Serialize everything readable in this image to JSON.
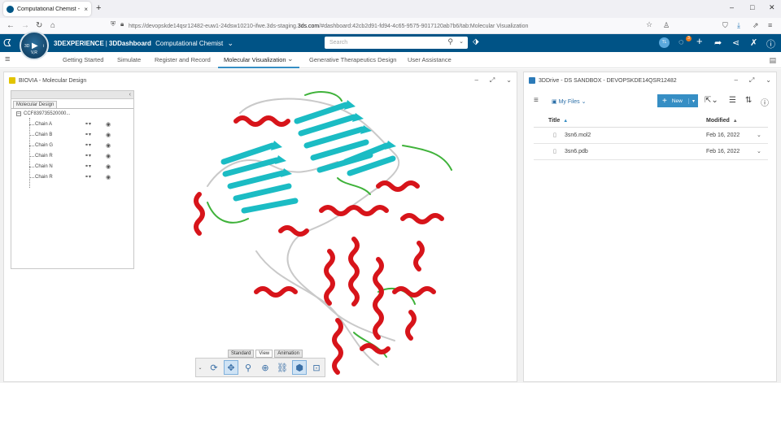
{
  "browser": {
    "tab_title": "Computational Chemist - Mol",
    "tab_close": "×",
    "new_tab": "+",
    "url_prefix": "https://devopskde14qsr12482-euw1-24dsw10210-ifwe.",
    "url_domain": "3ds.com",
    "url_staging": "3ds-staging.",
    "url_suffix": "/#dashboard:42cb2d91-fd94-4c65-9575-9017120ab7b6/tab:Molecular Visualization",
    "win_min": "–",
    "win_max": "□",
    "win_close": "✕"
  },
  "header": {
    "brand_3d": "3DEXPERIENCE",
    "brand_sep": "|",
    "brand_dash": "3DDashboard",
    "brand_app": "Computational Chemist",
    "brand_caret": "⌄",
    "search_placeholder": "Search",
    "compass_left": "3D",
    "compass_right": "i",
    "compass_bottom": "V,R",
    "avatar": "TL",
    "notif_count": "3",
    "colors": {
      "header_bg": "#005386",
      "accent": "#368ec4"
    }
  },
  "dashboard_tabs": [
    {
      "label": "Getting Started"
    },
    {
      "label": "Simulate"
    },
    {
      "label": "Register and Record"
    },
    {
      "label": "Molecular Visualization",
      "active": true
    },
    {
      "label": "Generative Therapeutics Design"
    },
    {
      "label": "User Assistance"
    }
  ],
  "left_widget": {
    "title": "BIOVIA - Molecular Design",
    "tree_tab": "Molecular Design",
    "tree_collapse": "‹",
    "root_toggle": "–",
    "root_label": "CCF8397355200​00...",
    "chains": [
      "Chain A",
      "Chain B",
      "Chain G",
      "Chain R",
      "Chain N",
      "Chain R"
    ],
    "chain_link_icon": "⚭▾",
    "chain_eye_icon": "◉",
    "toolbar_tabs": [
      "Standard",
      "View",
      "Animation"
    ],
    "toolbar_caret": "⌄"
  },
  "right_widget": {
    "title": "3DDrive - DS SANDBOX - DEVOPSKDE14QSR12482",
    "files_label": "My Files",
    "files_caret": "⌄",
    "new_label": "New",
    "new_plus": "+",
    "new_caret": "▾",
    "columns": {
      "title": "Title",
      "modified": "Modified",
      "sort_arrow": "▲"
    },
    "rows": [
      {
        "name": "3sn6.mol2",
        "modified": "Feb 16, 2022"
      },
      {
        "name": "3sn6.pdb",
        "modified": "Feb 16, 2022"
      }
    ],
    "row_caret": "⌄"
  }
}
